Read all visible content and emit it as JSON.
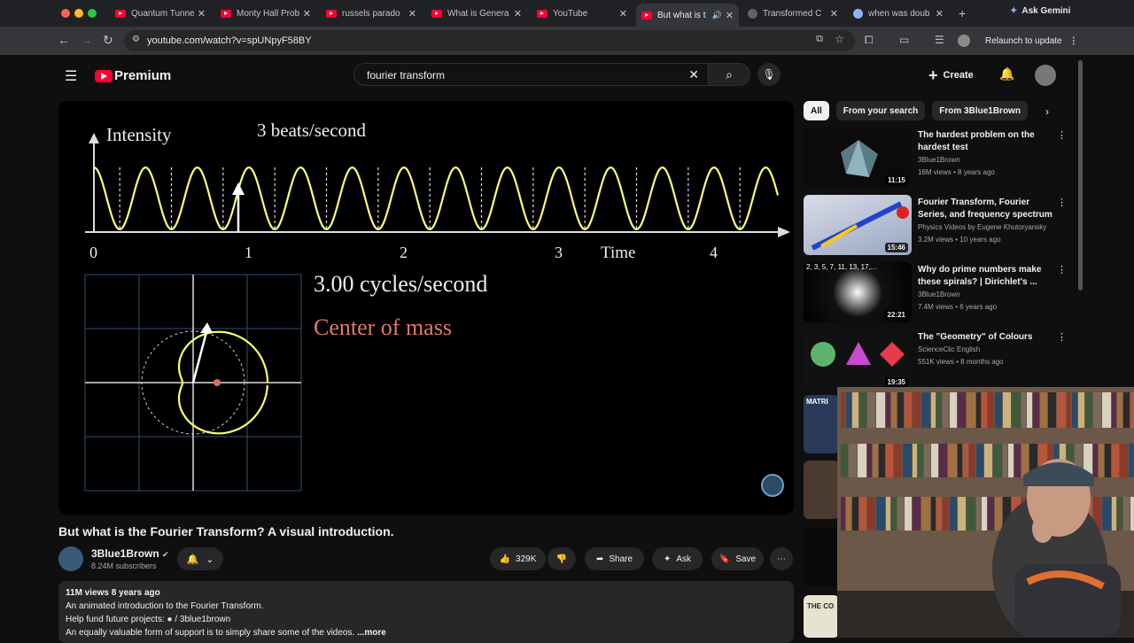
{
  "browser": {
    "tabs": [
      {
        "title": "Quantum Tunne",
        "icon": "youtube"
      },
      {
        "title": "Monty Hall Prob",
        "icon": "youtube"
      },
      {
        "title": "russels parado",
        "icon": "youtube"
      },
      {
        "title": "What is Genera",
        "icon": "youtube"
      },
      {
        "title": "YouTube",
        "icon": "youtube"
      },
      {
        "title": "But what is t",
        "icon": "youtube"
      },
      {
        "title": "Transformed C",
        "icon": "web"
      },
      {
        "title": "when was doub",
        "icon": "google"
      }
    ],
    "ask_gemini": "Ask Gemini",
    "url": "youtube.com/watch?v=spUNpyF58BY",
    "relaunch": "Relaunch to update"
  },
  "youtube": {
    "logo": "Premium",
    "search": {
      "value": "fourier transform"
    },
    "create": "Create"
  },
  "video": {
    "overlay": {
      "intensity": "Intensity",
      "beats": "3 beats/second",
      "time_label": "Time",
      "ticks": [
        "0",
        "1",
        "2",
        "3",
        "4"
      ],
      "cycles": "3.00 cycles/second",
      "center_of_mass": "Center of mass"
    },
    "title": "But what is the Fourier Transform? A visual introduction.",
    "channel": {
      "name": "3Blue1Brown",
      "subs": "8.24M subscribers"
    },
    "likes": "329K",
    "share": "Share",
    "ask": "Ask",
    "save": "Save",
    "description": {
      "meta": "11M views  8 years ago",
      "line1": "An animated introduction to the Fourier Transform.",
      "line2_prefix": "Help fund future projects: ",
      "line2_link": "/ 3blue1brown",
      "line3": "An equally valuable form of support is to simply share some of the videos.",
      "more": "...more"
    }
  },
  "sidebar": {
    "chips": [
      "All",
      "From your search",
      "From 3Blue1Brown"
    ],
    "recommendations": [
      {
        "title": "The hardest problem on the hardest test",
        "channel": "3Blue1Brown",
        "meta": "16M views • 8 years ago",
        "duration": "11:15"
      },
      {
        "title": "Fourier Transform, Fourier Series, and frequency spectrum",
        "channel": "Physics Videos by Eugene Khutoryansky",
        "meta": "3.2M views • 10 years ago",
        "duration": "15:46"
      },
      {
        "title": "Why do prime numbers make these spirals? | Dirichlet's ...",
        "channel": "3Blue1Brown",
        "meta": "7.4M views • 6 years ago",
        "duration": "22:21",
        "thumb_text": "2, 3, 5, 7, 11, 13, 17,..."
      },
      {
        "title": "The \"Geometry\" of Colours",
        "channel": "ScienceClic English",
        "meta": "551K views • 8 months ago",
        "duration": "19:35"
      }
    ],
    "partial_thumbs": [
      "MATRI",
      "THE CO"
    ]
  }
}
